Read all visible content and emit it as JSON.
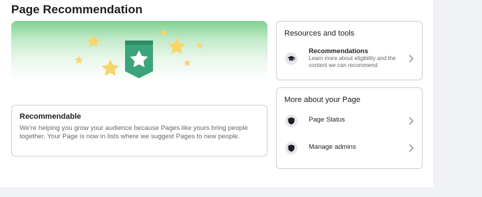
{
  "page": {
    "title": "Page Recommendation"
  },
  "colors": {
    "hero_green": "#7fd18f",
    "badge_green": "#3aa57a",
    "star_yellow": "#f7d56b",
    "border": "#ccd0d5"
  },
  "status_card": {
    "title": "Recommendable",
    "description": "We're helping you grow your audience because Pages like yours bring people together. Your Page is now in lists where we suggest Pages to new people."
  },
  "resources": {
    "heading": "Resources and tools",
    "items": [
      {
        "label": "Recommendations",
        "sublabel": "Learn more about eligibility and the content we can recommend",
        "icon": "graduation-cap-icon"
      }
    ]
  },
  "more": {
    "heading": "More about your Page",
    "items": [
      {
        "label": "Page Status",
        "icon": "shield-icon"
      },
      {
        "label": "Manage admins",
        "icon": "shield-icon"
      }
    ]
  }
}
